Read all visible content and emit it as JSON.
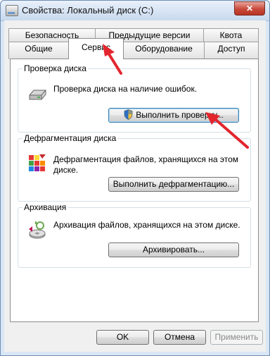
{
  "window": {
    "title": "Свойства: Локальный диск (C:)",
    "close_label": "✕"
  },
  "tabs": {
    "row1": [
      "Безопасность",
      "Предыдущие версии",
      "Квота"
    ],
    "row2": [
      "Общие",
      "Сервис",
      "Оборудование",
      "Доступ"
    ],
    "active": "Сервис"
  },
  "groups": {
    "check": {
      "title": "Проверка диска",
      "description": "Проверка диска на наличие ошибок.",
      "button": "Выполнить проверку..."
    },
    "defrag": {
      "title": "Дефрагментация диска",
      "description": "Дефрагментация файлов, хранящихся на этом диске.",
      "button": "Выполнить дефрагментацию..."
    },
    "archive": {
      "title": "Архивация",
      "description": "Архивация файлов, хранящихся на этом диске.",
      "button": "Архивировать..."
    }
  },
  "footer": {
    "ok": "OK",
    "cancel": "Отмена",
    "apply": "Применить"
  },
  "colors": {
    "annotation_arrow": "#e3252d",
    "title_bar": "#c8d9ee",
    "close_button": "#c8493a"
  }
}
